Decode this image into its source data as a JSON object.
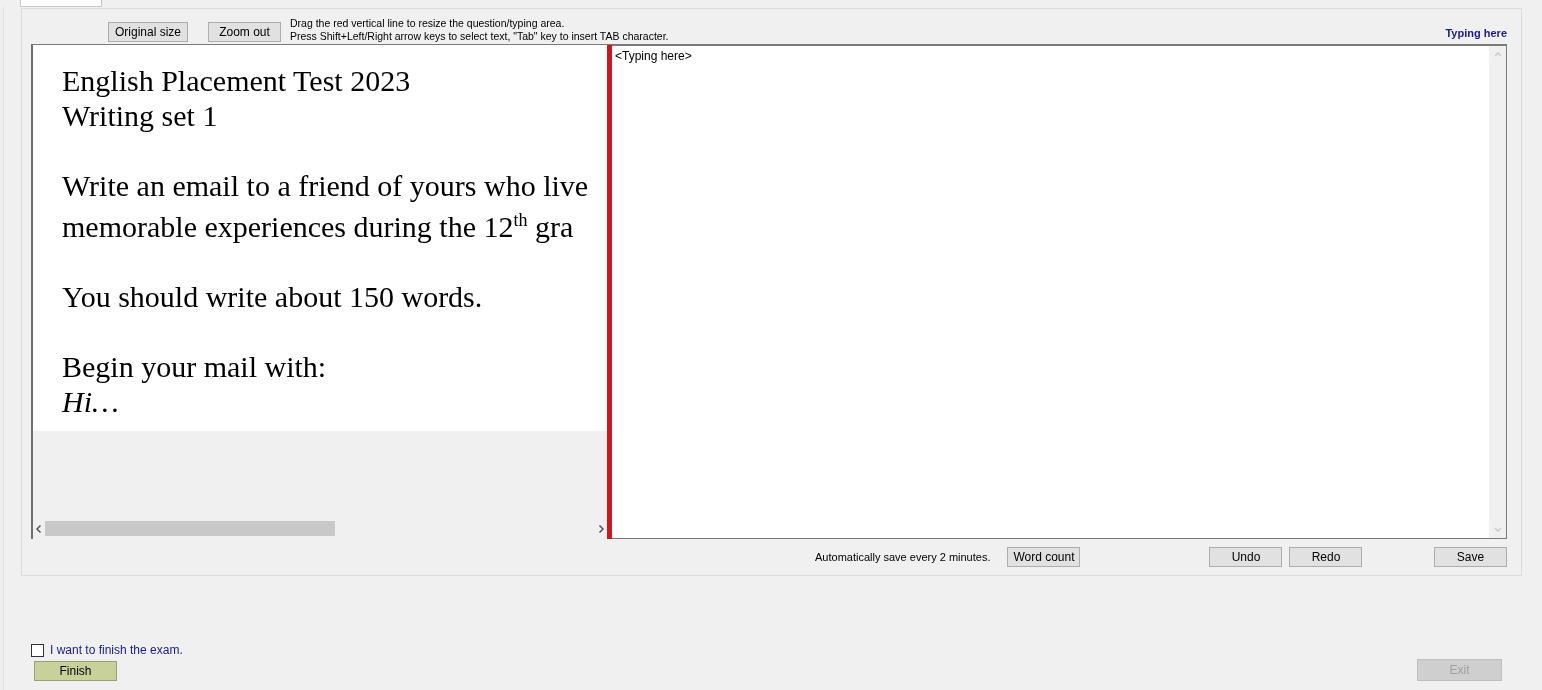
{
  "toolbar": {
    "buttons": [
      {
        "label": "Original size"
      },
      {
        "label": "Zoom out"
      }
    ],
    "hints": [
      "Drag the red vertical line to resize the question/typing area.",
      "Press Shift+Left/Right arrow keys to select text, \"Tab\" key to insert TAB character."
    ],
    "mode_label": "Typing here"
  },
  "question": {
    "paragraphs": [
      {
        "lines": [
          {
            "text": "English Placement Test 2023",
            "italic": false
          },
          {
            "text": "Writing set 1",
            "italic": false
          }
        ]
      },
      {
        "lines": [
          {
            "text": "Write an email to a friend of yours who live",
            "italic": false
          },
          {
            "text": "memorable experiences during the 12$^{th}$ gra",
            "italic": false
          }
        ]
      },
      {
        "lines": [
          {
            "text": "You should write about 150 words.",
            "italic": false
          }
        ]
      },
      {
        "lines": [
          {
            "text": "Begin your mail with:",
            "italic": false
          },
          {
            "text": "Hi…",
            "italic": true
          }
        ]
      }
    ]
  },
  "answer": {
    "value": "<Typing here>"
  },
  "footer": {
    "autosave_note": "Automatically save every 2 minutes.",
    "buttons": [
      {
        "label": "Word count",
        "kind": "left"
      },
      {
        "label": "Undo",
        "kind": "middle"
      },
      {
        "label": "Redo",
        "kind": "middle"
      },
      {
        "label": "Save",
        "kind": "right"
      }
    ]
  },
  "finish": {
    "checkbox": {
      "label": "I want to finish the exam.",
      "checked": false
    },
    "finish_button": {
      "label": "Finish"
    },
    "exit_button": {
      "label": "Exit",
      "disabled": true
    }
  }
}
